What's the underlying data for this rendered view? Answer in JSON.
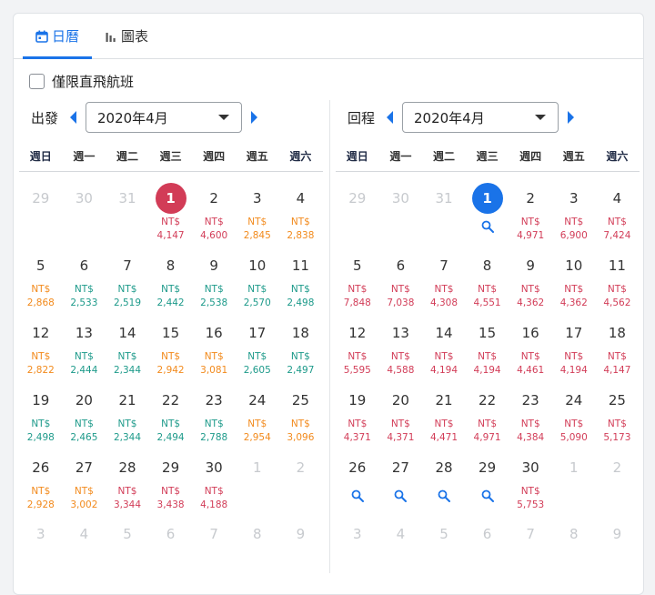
{
  "tabs": [
    {
      "label": "日曆",
      "icon": "calendar-icon",
      "active": true
    },
    {
      "label": "圖表",
      "icon": "bar-chart-icon",
      "active": false
    }
  ],
  "direct_only_label": "僅限直飛航班",
  "weekdays": [
    "週日",
    "週一",
    "週二",
    "週三",
    "週四",
    "週五",
    "週六"
  ],
  "colors": {
    "accent": "#1a73e8",
    "selected_departure": "#d23c57",
    "cheap": "#1d9a8a",
    "mid": "#f28a1c",
    "expensive": "#d23c57"
  },
  "departure": {
    "label": "出發",
    "month": "2020年4月",
    "days": [
      {
        "d": "29",
        "out": true
      },
      {
        "d": "30",
        "out": true
      },
      {
        "d": "31",
        "out": true
      },
      {
        "d": "1",
        "sel": "red",
        "cur": "NT$",
        "price": "4,147",
        "c": "red"
      },
      {
        "d": "2",
        "cur": "NT$",
        "price": "4,600",
        "c": "red"
      },
      {
        "d": "3",
        "cur": "NT$",
        "price": "2,845",
        "c": "orange"
      },
      {
        "d": "4",
        "cur": "NT$",
        "price": "2,838",
        "c": "orange"
      },
      {
        "d": "5",
        "cur": "NT$",
        "price": "2,868",
        "c": "orange"
      },
      {
        "d": "6",
        "cur": "NT$",
        "price": "2,533",
        "c": "green"
      },
      {
        "d": "7",
        "cur": "NT$",
        "price": "2,519",
        "c": "green"
      },
      {
        "d": "8",
        "cur": "NT$",
        "price": "2,442",
        "c": "green"
      },
      {
        "d": "9",
        "cur": "NT$",
        "price": "2,538",
        "c": "green"
      },
      {
        "d": "10",
        "cur": "NT$",
        "price": "2,570",
        "c": "green"
      },
      {
        "d": "11",
        "cur": "NT$",
        "price": "2,498",
        "c": "green"
      },
      {
        "d": "12",
        "cur": "NT$",
        "price": "2,822",
        "c": "orange"
      },
      {
        "d": "13",
        "cur": "NT$",
        "price": "2,444",
        "c": "green"
      },
      {
        "d": "14",
        "cur": "NT$",
        "price": "2,344",
        "c": "green"
      },
      {
        "d": "15",
        "cur": "NT$",
        "price": "2,942",
        "c": "orange"
      },
      {
        "d": "16",
        "cur": "NT$",
        "price": "3,081",
        "c": "orange"
      },
      {
        "d": "17",
        "cur": "NT$",
        "price": "2,605",
        "c": "green"
      },
      {
        "d": "18",
        "cur": "NT$",
        "price": "2,497",
        "c": "green"
      },
      {
        "d": "19",
        "cur": "NT$",
        "price": "2,498",
        "c": "green"
      },
      {
        "d": "20",
        "cur": "NT$",
        "price": "2,465",
        "c": "green"
      },
      {
        "d": "21",
        "cur": "NT$",
        "price": "2,344",
        "c": "green"
      },
      {
        "d": "22",
        "cur": "NT$",
        "price": "2,494",
        "c": "green"
      },
      {
        "d": "23",
        "cur": "NT$",
        "price": "2,788",
        "c": "green"
      },
      {
        "d": "24",
        "cur": "NT$",
        "price": "2,954",
        "c": "orange"
      },
      {
        "d": "25",
        "cur": "NT$",
        "price": "3,096",
        "c": "orange"
      },
      {
        "d": "26",
        "cur": "NT$",
        "price": "2,928",
        "c": "orange"
      },
      {
        "d": "27",
        "cur": "NT$",
        "price": "3,002",
        "c": "orange"
      },
      {
        "d": "28",
        "cur": "NT$",
        "price": "3,344",
        "c": "red"
      },
      {
        "d": "29",
        "cur": "NT$",
        "price": "3,438",
        "c": "red"
      },
      {
        "d": "30",
        "cur": "NT$",
        "price": "4,188",
        "c": "red"
      },
      {
        "d": "1",
        "out": true
      },
      {
        "d": "2",
        "out": true
      },
      {
        "d": "3",
        "out": true
      },
      {
        "d": "4",
        "out": true
      },
      {
        "d": "5",
        "out": true
      },
      {
        "d": "6",
        "out": true
      },
      {
        "d": "7",
        "out": true
      },
      {
        "d": "8",
        "out": true
      },
      {
        "d": "9",
        "out": true
      }
    ]
  },
  "return": {
    "label": "回程",
    "month": "2020年4月",
    "days": [
      {
        "d": "29",
        "out": true
      },
      {
        "d": "30",
        "out": true
      },
      {
        "d": "31",
        "out": true
      },
      {
        "d": "1",
        "sel": "blue",
        "search": true
      },
      {
        "d": "2",
        "cur": "NT$",
        "price": "4,971",
        "c": "red"
      },
      {
        "d": "3",
        "cur": "NT$",
        "price": "6,900",
        "c": "red"
      },
      {
        "d": "4",
        "cur": "NT$",
        "price": "7,424",
        "c": "red"
      },
      {
        "d": "5",
        "cur": "NT$",
        "price": "7,848",
        "c": "red"
      },
      {
        "d": "6",
        "cur": "NT$",
        "price": "7,038",
        "c": "red"
      },
      {
        "d": "7",
        "cur": "NT$",
        "price": "4,308",
        "c": "red"
      },
      {
        "d": "8",
        "cur": "NT$",
        "price": "4,551",
        "c": "red"
      },
      {
        "d": "9",
        "cur": "NT$",
        "price": "4,362",
        "c": "red"
      },
      {
        "d": "10",
        "cur": "NT$",
        "price": "4,362",
        "c": "red"
      },
      {
        "d": "11",
        "cur": "NT$",
        "price": "4,562",
        "c": "red"
      },
      {
        "d": "12",
        "cur": "NT$",
        "price": "5,595",
        "c": "red"
      },
      {
        "d": "13",
        "cur": "NT$",
        "price": "4,588",
        "c": "red"
      },
      {
        "d": "14",
        "cur": "NT$",
        "price": "4,194",
        "c": "red"
      },
      {
        "d": "15",
        "cur": "NT$",
        "price": "4,194",
        "c": "red"
      },
      {
        "d": "16",
        "cur": "NT$",
        "price": "4,461",
        "c": "red"
      },
      {
        "d": "17",
        "cur": "NT$",
        "price": "4,194",
        "c": "red"
      },
      {
        "d": "18",
        "cur": "NT$",
        "price": "4,147",
        "c": "red"
      },
      {
        "d": "19",
        "cur": "NT$",
        "price": "4,371",
        "c": "red"
      },
      {
        "d": "20",
        "cur": "NT$",
        "price": "4,371",
        "c": "red"
      },
      {
        "d": "21",
        "cur": "NT$",
        "price": "4,471",
        "c": "red"
      },
      {
        "d": "22",
        "cur": "NT$",
        "price": "4,971",
        "c": "red"
      },
      {
        "d": "23",
        "cur": "NT$",
        "price": "4,384",
        "c": "red"
      },
      {
        "d": "24",
        "cur": "NT$",
        "price": "5,090",
        "c": "red"
      },
      {
        "d": "25",
        "cur": "NT$",
        "price": "5,173",
        "c": "red"
      },
      {
        "d": "26",
        "search": true
      },
      {
        "d": "27",
        "search": true
      },
      {
        "d": "28",
        "search": true
      },
      {
        "d": "29",
        "search": true
      },
      {
        "d": "30",
        "cur": "NT$",
        "price": "5,753",
        "c": "red"
      },
      {
        "d": "1",
        "out": true
      },
      {
        "d": "2",
        "out": true
      },
      {
        "d": "3",
        "out": true
      },
      {
        "d": "4",
        "out": true
      },
      {
        "d": "5",
        "out": true
      },
      {
        "d": "6",
        "out": true
      },
      {
        "d": "7",
        "out": true
      },
      {
        "d": "8",
        "out": true
      },
      {
        "d": "9",
        "out": true
      }
    ]
  }
}
